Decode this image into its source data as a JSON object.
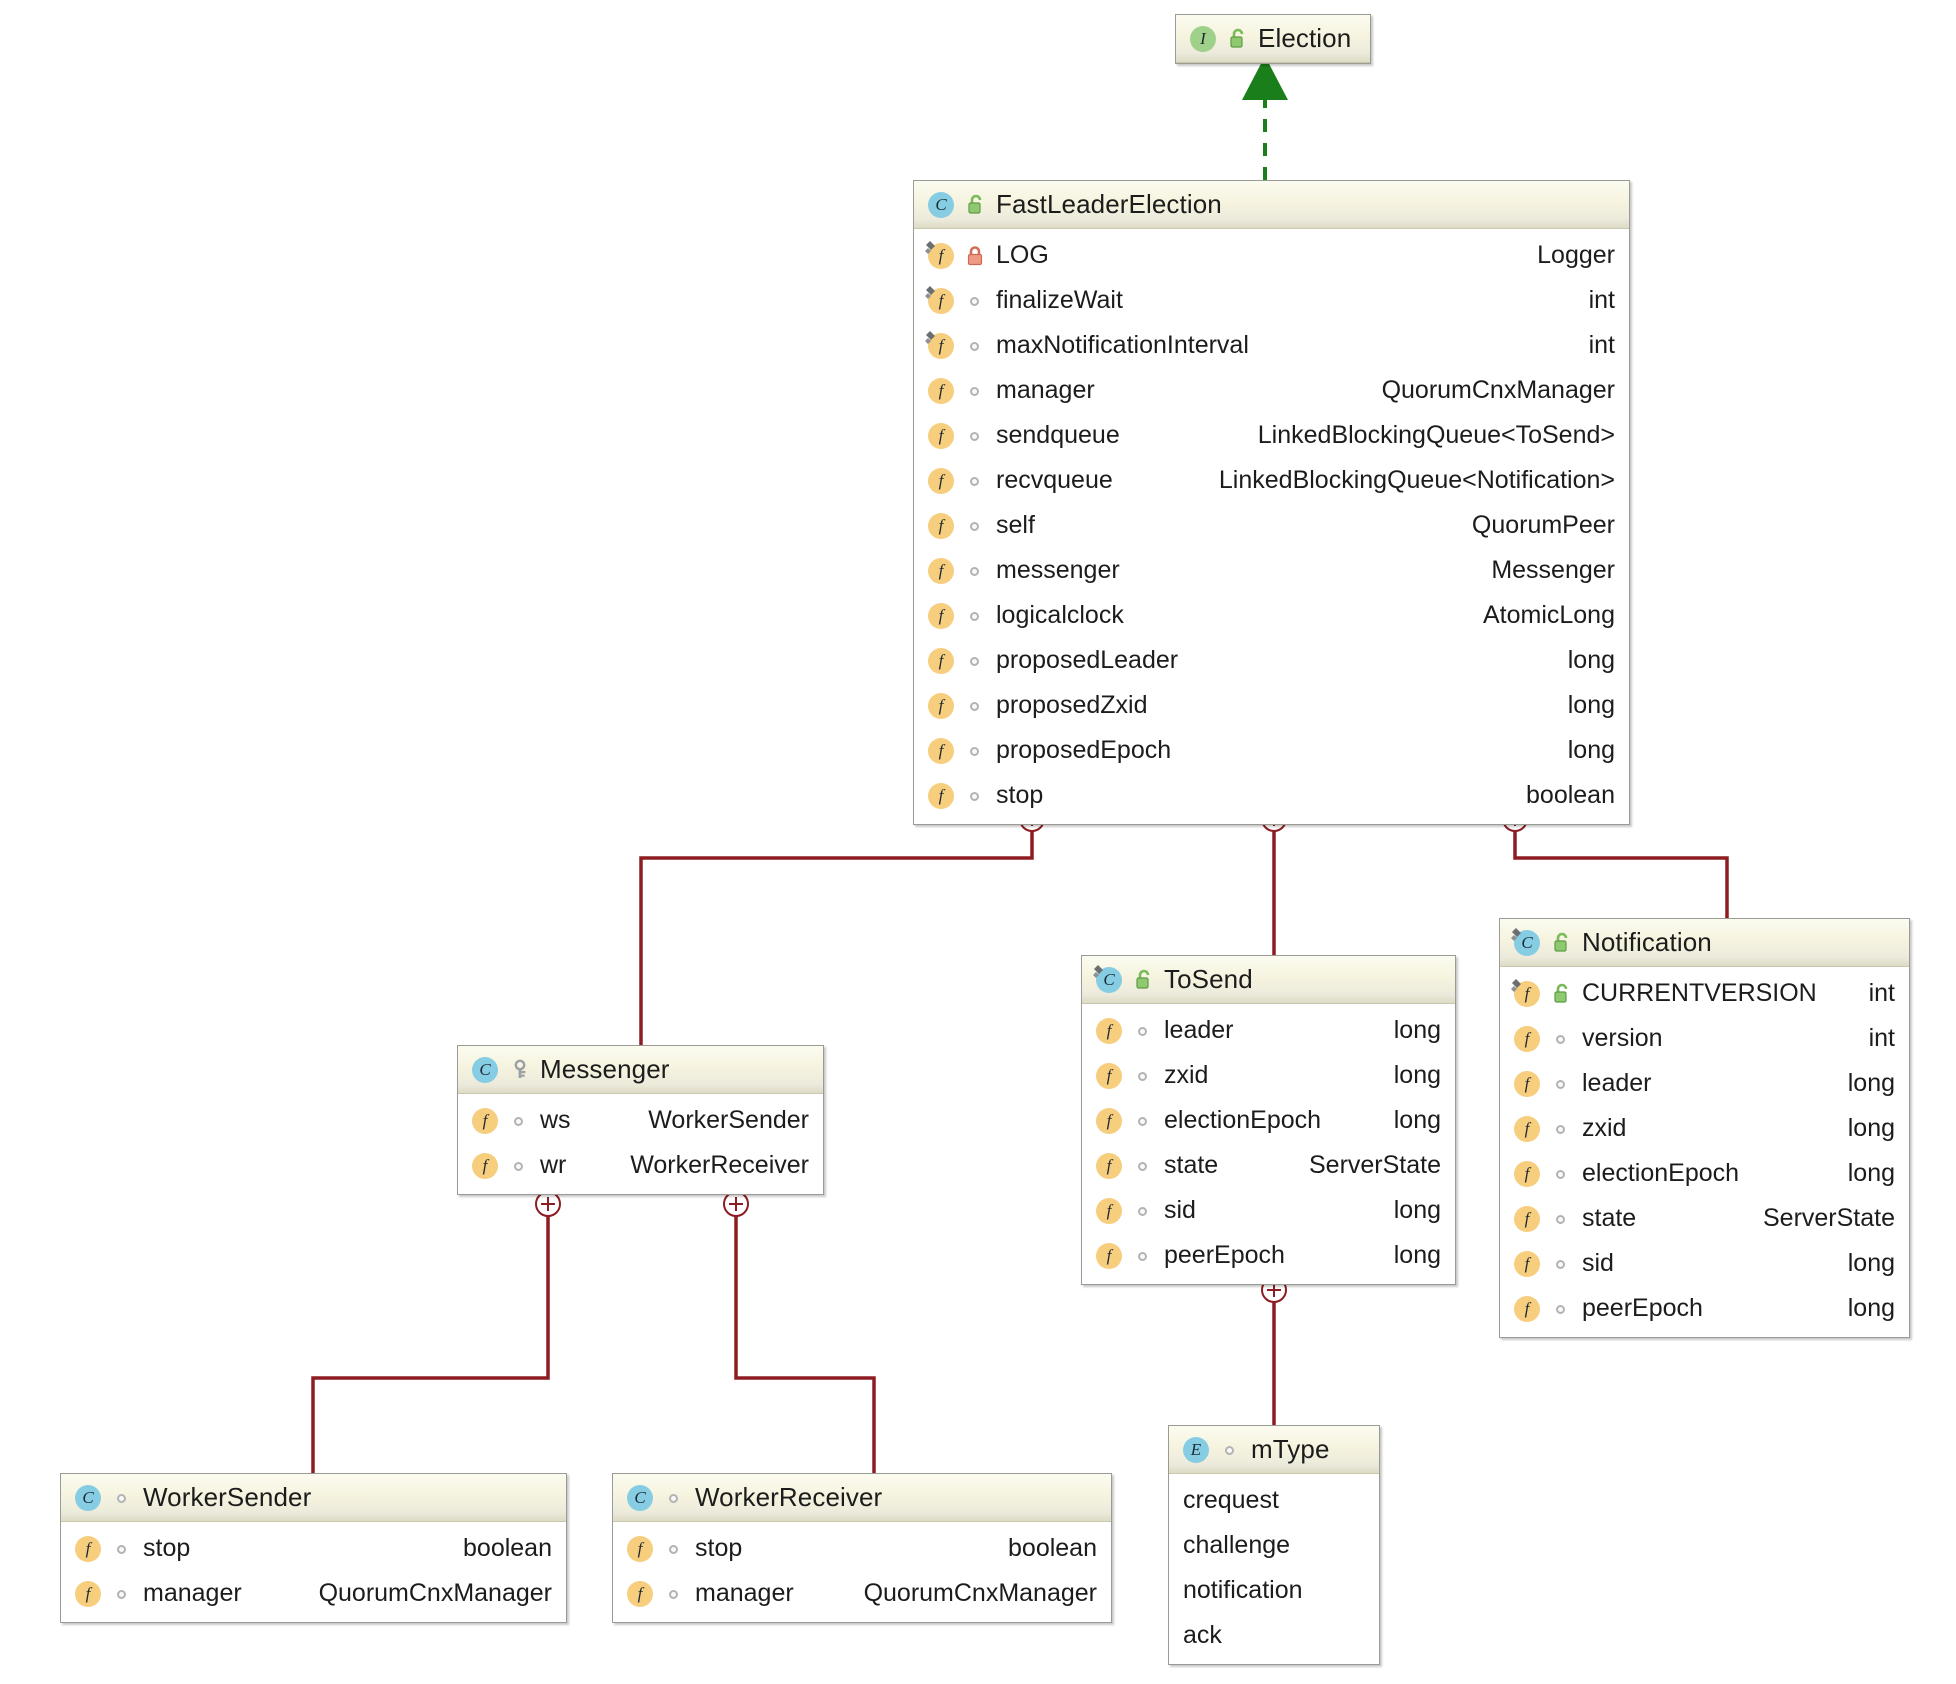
{
  "diagram": {
    "title": "FastLeaderElection class diagram",
    "colors": {
      "composition_line": "#8d1d23",
      "realization_line": "#1a7f1a",
      "header_gradient_top": "#fbfbf0",
      "header_gradient_bottom": "#dddbc4",
      "class_icon": "#86cde4",
      "interface_icon": "#9fd18a",
      "field_icon": "#f7cd7e",
      "private_lock": "#e8927c",
      "public_lock": "#7cbb5a",
      "border": "#9b9b96"
    }
  },
  "nodes": {
    "election": {
      "name": "Election",
      "kind": "interface",
      "kind_icon": "interface-icon",
      "visibility": "public",
      "visibility_icon": "unlock-green-icon",
      "members": []
    },
    "fast_leader_election": {
      "name": "FastLeaderElection",
      "kind": "class",
      "kind_icon": "class-icon",
      "visibility": "public",
      "visibility_icon": "unlock-green-icon",
      "members": [
        {
          "name": "LOG",
          "type": "Logger",
          "icon": "static-field-icon",
          "visibility": "private",
          "vis_icon": "lock-red-icon",
          "static": true
        },
        {
          "name": "finalizeWait",
          "type": "int",
          "icon": "static-field-icon",
          "visibility": "package",
          "vis_icon": "package-circle-icon",
          "static": true
        },
        {
          "name": "maxNotificationInterval",
          "type": "int",
          "icon": "static-field-icon",
          "visibility": "package",
          "vis_icon": "package-circle-icon",
          "static": true
        },
        {
          "name": "manager",
          "type": "QuorumCnxManager",
          "icon": "field-icon",
          "visibility": "package",
          "vis_icon": "package-circle-icon",
          "static": false
        },
        {
          "name": "sendqueue",
          "type": "LinkedBlockingQueue<ToSend>",
          "icon": "field-icon",
          "visibility": "package",
          "vis_icon": "package-circle-icon",
          "static": false
        },
        {
          "name": "recvqueue",
          "type": "LinkedBlockingQueue<Notification>",
          "icon": "field-icon",
          "visibility": "package",
          "vis_icon": "package-circle-icon",
          "static": false
        },
        {
          "name": "self",
          "type": "QuorumPeer",
          "icon": "field-icon",
          "visibility": "package",
          "vis_icon": "package-circle-icon",
          "static": false
        },
        {
          "name": "messenger",
          "type": "Messenger",
          "icon": "field-icon",
          "visibility": "package",
          "vis_icon": "package-circle-icon",
          "static": false
        },
        {
          "name": "logicalclock",
          "type": "AtomicLong",
          "icon": "field-icon",
          "visibility": "package",
          "vis_icon": "package-circle-icon",
          "static": false
        },
        {
          "name": "proposedLeader",
          "type": "long",
          "icon": "field-icon",
          "visibility": "package",
          "vis_icon": "package-circle-icon",
          "static": false
        },
        {
          "name": "proposedZxid",
          "type": "long",
          "icon": "field-icon",
          "visibility": "package",
          "vis_icon": "package-circle-icon",
          "static": false
        },
        {
          "name": "proposedEpoch",
          "type": "long",
          "icon": "field-icon",
          "visibility": "package",
          "vis_icon": "package-circle-icon",
          "static": false
        },
        {
          "name": "stop",
          "type": "boolean",
          "icon": "field-icon",
          "visibility": "package",
          "vis_icon": "package-circle-icon",
          "static": false
        }
      ]
    },
    "messenger": {
      "name": "Messenger",
      "kind": "class",
      "kind_icon": "class-icon",
      "visibility": "protected",
      "visibility_icon": "key-icon",
      "members": [
        {
          "name": "ws",
          "type": "WorkerSender",
          "icon": "field-icon",
          "visibility": "package",
          "vis_icon": "package-circle-icon",
          "static": false
        },
        {
          "name": "wr",
          "type": "WorkerReceiver",
          "icon": "field-icon",
          "visibility": "package",
          "vis_icon": "package-circle-icon",
          "static": false
        }
      ]
    },
    "to_send": {
      "name": "ToSend",
      "kind": "class",
      "kind_icon": "static-class-icon",
      "visibility": "public",
      "visibility_icon": "unlock-green-icon",
      "members": [
        {
          "name": "leader",
          "type": "long",
          "icon": "field-icon",
          "visibility": "package",
          "vis_icon": "package-circle-icon",
          "static": false
        },
        {
          "name": "zxid",
          "type": "long",
          "icon": "field-icon",
          "visibility": "package",
          "vis_icon": "package-circle-icon",
          "static": false
        },
        {
          "name": "electionEpoch",
          "type": "long",
          "icon": "field-icon",
          "visibility": "package",
          "vis_icon": "package-circle-icon",
          "static": false
        },
        {
          "name": "state",
          "type": "ServerState",
          "icon": "field-icon",
          "visibility": "package",
          "vis_icon": "package-circle-icon",
          "static": false
        },
        {
          "name": "sid",
          "type": "long",
          "icon": "field-icon",
          "visibility": "package",
          "vis_icon": "package-circle-icon",
          "static": false
        },
        {
          "name": "peerEpoch",
          "type": "long",
          "icon": "field-icon",
          "visibility": "package",
          "vis_icon": "package-circle-icon",
          "static": false
        }
      ]
    },
    "notification": {
      "name": "Notification",
      "kind": "class",
      "kind_icon": "static-class-icon",
      "visibility": "public",
      "visibility_icon": "unlock-green-icon",
      "members": [
        {
          "name": "CURRENTVERSION",
          "type": "int",
          "icon": "static-field-icon",
          "visibility": "public",
          "vis_icon": "unlock-green-icon",
          "static": true
        },
        {
          "name": "version",
          "type": "int",
          "icon": "field-icon",
          "visibility": "package",
          "vis_icon": "package-circle-icon",
          "static": false
        },
        {
          "name": "leader",
          "type": "long",
          "icon": "field-icon",
          "visibility": "package",
          "vis_icon": "package-circle-icon",
          "static": false
        },
        {
          "name": "zxid",
          "type": "long",
          "icon": "field-icon",
          "visibility": "package",
          "vis_icon": "package-circle-icon",
          "static": false
        },
        {
          "name": "electionEpoch",
          "type": "long",
          "icon": "field-icon",
          "visibility": "package",
          "vis_icon": "package-circle-icon",
          "static": false
        },
        {
          "name": "state",
          "type": "ServerState",
          "icon": "field-icon",
          "visibility": "package",
          "vis_icon": "package-circle-icon",
          "static": false
        },
        {
          "name": "sid",
          "type": "long",
          "icon": "field-icon",
          "visibility": "package",
          "vis_icon": "package-circle-icon",
          "static": false
        },
        {
          "name": "peerEpoch",
          "type": "long",
          "icon": "field-icon",
          "visibility": "package",
          "vis_icon": "package-circle-icon",
          "static": false
        }
      ]
    },
    "worker_sender": {
      "name": "WorkerSender",
      "kind": "class",
      "kind_icon": "class-icon",
      "visibility": "package",
      "visibility_icon": "package-circle-icon",
      "members": [
        {
          "name": "stop",
          "type": "boolean",
          "icon": "field-icon",
          "visibility": "package",
          "vis_icon": "package-circle-icon",
          "static": false
        },
        {
          "name": "manager",
          "type": "QuorumCnxManager",
          "icon": "field-icon",
          "visibility": "package",
          "vis_icon": "package-circle-icon",
          "static": false
        }
      ]
    },
    "worker_receiver": {
      "name": "WorkerReceiver",
      "kind": "class",
      "kind_icon": "class-icon",
      "visibility": "package",
      "visibility_icon": "package-circle-icon",
      "members": [
        {
          "name": "stop",
          "type": "boolean",
          "icon": "field-icon",
          "visibility": "package",
          "vis_icon": "package-circle-icon",
          "static": false
        },
        {
          "name": "manager",
          "type": "QuorumCnxManager",
          "icon": "field-icon",
          "visibility": "package",
          "vis_icon": "package-circle-icon",
          "static": false
        }
      ]
    },
    "m_type": {
      "name": "mType",
      "kind": "enum",
      "kind_icon": "enum-icon",
      "visibility": "package",
      "visibility_icon": "package-circle-icon",
      "literals": [
        "crequest",
        "challenge",
        "notification",
        "ack"
      ]
    }
  },
  "edges": [
    {
      "from": "FastLeaderElection",
      "to": "Election",
      "type": "realization",
      "style": "dashed-green-arrow"
    },
    {
      "from": "FastLeaderElection",
      "to": "Messenger",
      "type": "nested",
      "style": "plus-connector"
    },
    {
      "from": "FastLeaderElection",
      "to": "ToSend",
      "type": "nested",
      "style": "plus-connector"
    },
    {
      "from": "FastLeaderElection",
      "to": "Notification",
      "type": "nested",
      "style": "plus-connector"
    },
    {
      "from": "Messenger",
      "to": "WorkerSender",
      "type": "nested",
      "style": "plus-connector"
    },
    {
      "from": "Messenger",
      "to": "WorkerReceiver",
      "type": "nested",
      "style": "plus-connector"
    },
    {
      "from": "ToSend",
      "to": "mType",
      "type": "nested",
      "style": "plus-connector"
    }
  ]
}
